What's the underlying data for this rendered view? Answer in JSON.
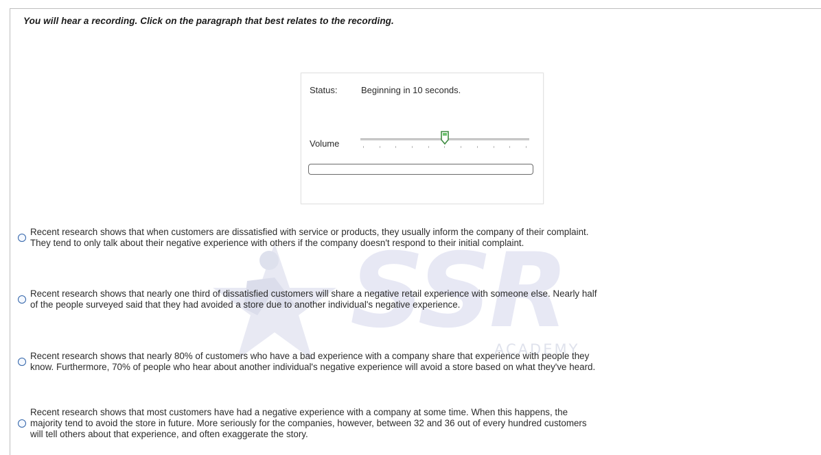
{
  "instruction": "You will hear a recording. Click on the paragraph that best relates to the recording.",
  "player": {
    "status_label": "Status:",
    "status_value": "Beginning in 10 seconds.",
    "volume_label": "Volume",
    "volume_level": 0.5,
    "progress": 0
  },
  "options": [
    {
      "line1": "Recent research shows that when customers are dissatisfied with service or products, they usually inform the company of their complaint.",
      "line2": "They tend to only talk about their negative experience with others if the company doesn't respond to their initial complaint.",
      "line3": ""
    },
    {
      "line1": "Recent research shows that nearly one third of dissatisfied customers will share a negative retail experience with someone else. Nearly half",
      "line2": "of the people surveyed said that they had avoided a store due to another individual's negative experience.",
      "line3": ""
    },
    {
      "line1": "Recent research shows that nearly 80% of customers who have a bad experience with a company share that experience with people they",
      "line2": "know.  Furthermore, 70% of people who hear about another individual's negative experience will avoid a store based on what they've heard.",
      "line3": ""
    },
    {
      "line1": "Recent research shows that most customers have had a negative experience with a company at some time. When this happens, the",
      "line2": "majority tend to avoid the store in future. More seriously for the companies, however, between 32 and 36 out of every hundred customers",
      "line3": "will tell others about that experience, and often exaggerate the story."
    }
  ],
  "watermark": {
    "letters": "SSR",
    "academy": "ACADEMY"
  },
  "colors": {
    "radio_border": "#2f62a8",
    "thumb_green": "#4caf50",
    "watermark": "#e3e5f3"
  },
  "icons": {
    "radio": "radio-button-icon",
    "thumb": "slider-thumb-icon",
    "watermark_logo": "star-runner-logo"
  }
}
